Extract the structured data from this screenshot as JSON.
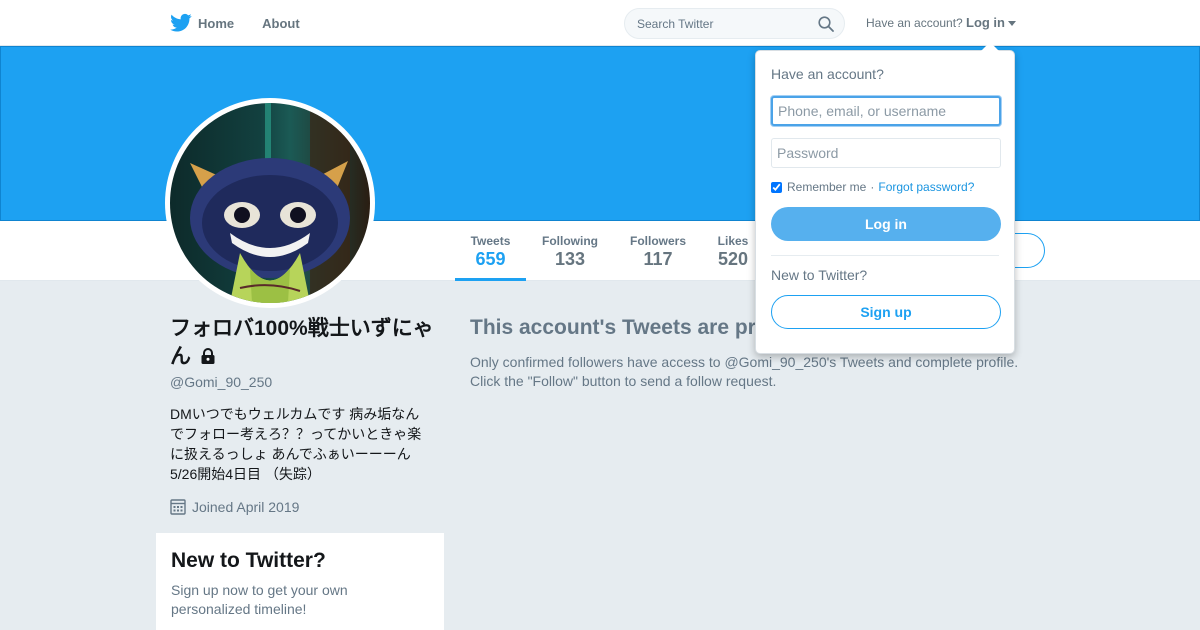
{
  "nav": {
    "home_label": "Home",
    "about_label": "About",
    "search_placeholder": "Search Twitter",
    "account_prompt": "Have an account?",
    "login_label": "Log in"
  },
  "profile": {
    "name": "フォロバ100%戦士いずにゃん",
    "handle": "@Gomi_90_250",
    "bio": "DMいつでもウェルカムです 病み垢なんでフォロー考えろ？？ってかいときゃ楽に扱えるっしょ あんでふぁいーーーん\n5/26開始4日目 （失踪）",
    "joined": "Joined April 2019",
    "protected": true
  },
  "stats": [
    {
      "label": "Tweets",
      "value": "659",
      "active": true
    },
    {
      "label": "Following",
      "value": "133",
      "active": false
    },
    {
      "label": "Followers",
      "value": "117",
      "active": false
    },
    {
      "label": "Likes",
      "value": "520",
      "active": false
    }
  ],
  "protected_notice": {
    "title": "This account's Tweets are pr",
    "text": "Only confirmed followers have access to @Gomi_90_250's Tweets and complete profile. Click the \"Follow\" button to send a follow request."
  },
  "signup_card": {
    "title": "New to Twitter?",
    "text": "Sign up now to get your own personalized timeline!"
  },
  "login_dropdown": {
    "heading": "Have an account?",
    "username_placeholder": "Phone, email, or username",
    "password_placeholder": "Password",
    "remember_label": "Remember me",
    "separator": "·",
    "forgot_label": "Forgot password?",
    "remember_checked": true,
    "login_button": "Log in",
    "new_prompt": "New to Twitter?",
    "signup_button": "Sign up"
  },
  "colors": {
    "brand": "#1da1f2",
    "banner": "#1da1f2",
    "page_bg": "#e6ecf0"
  },
  "icons": [
    "twitter-bird-icon",
    "search-icon",
    "chevron-down-icon",
    "lock-icon",
    "calendar-icon"
  ]
}
